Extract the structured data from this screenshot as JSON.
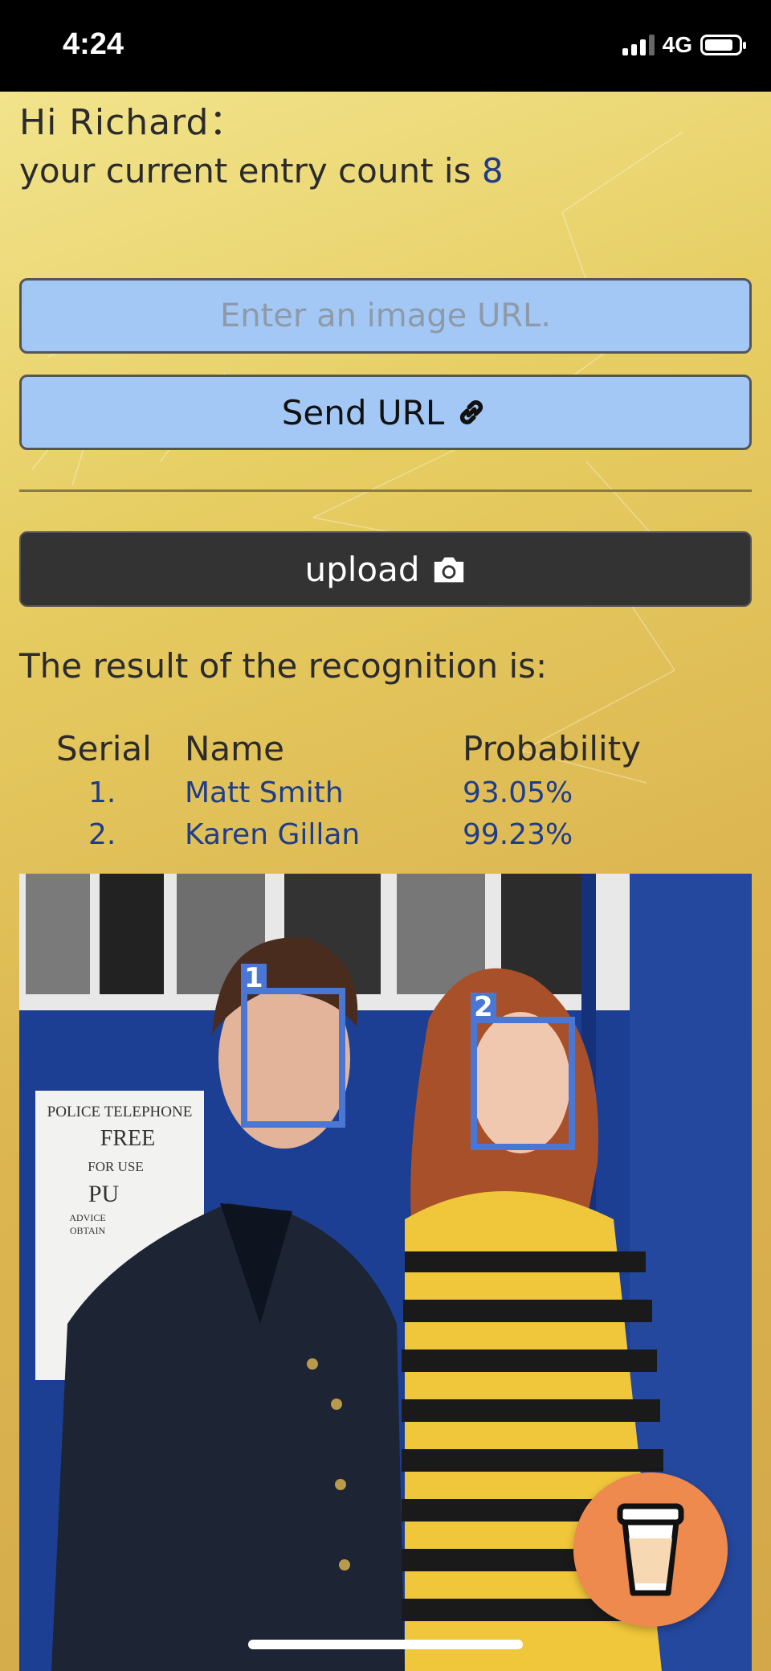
{
  "status_bar": {
    "time": "4:24",
    "network": "4G"
  },
  "greeting": {
    "text": "Hi Richard：",
    "entry_prefix": "your current entry count is ",
    "entry_count": "8"
  },
  "url_form": {
    "placeholder": "Enter an image URL.",
    "send_label": "Send URL"
  },
  "upload": {
    "label": "upload"
  },
  "results": {
    "heading": "The result of the recognition is:",
    "columns": [
      "Serial",
      "Name",
      "Probability"
    ],
    "rows": [
      {
        "serial": "1.",
        "name": "Matt Smith",
        "probability": "93.05%"
      },
      {
        "serial": "2.",
        "name": "Karen Gillan",
        "probability": "99.23%"
      }
    ]
  },
  "image": {
    "sign_lines": [
      "POLICE TELEPHONE",
      "FREE",
      "FOR USE",
      "PU",
      "ADVICE",
      "OBTAIN"
    ],
    "face_labels": [
      "1",
      "2"
    ]
  },
  "colors": {
    "accent": "#a3c8f5",
    "link": "#1f3d8a",
    "box": "#4a76d4",
    "coffee": "#ee8a4e"
  },
  "icons": {
    "send": "link-icon",
    "upload": "camera-icon",
    "floating": "coffee-cup-icon"
  }
}
